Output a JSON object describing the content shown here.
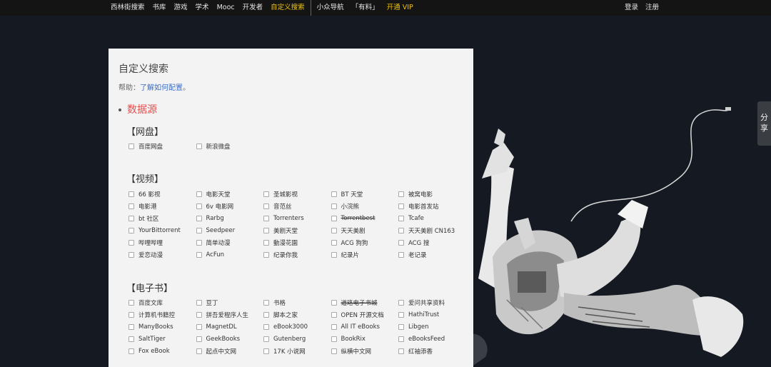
{
  "topnav": {
    "items": [
      "西林街搜索",
      "书库",
      "游戏",
      "学术",
      "Mooc",
      "开发者",
      "自定义搜索",
      "小众导航",
      "「有料」",
      "开通 VIP"
    ],
    "active": "自定义搜索",
    "login": "登录",
    "register": "注册"
  },
  "share": {
    "label": "分享"
  },
  "panel": {
    "title": "自定义搜索",
    "help_prefix": "帮助：",
    "help_link": "了解如何配置",
    "help_suffix": "。",
    "section_title": "数据源"
  },
  "groups": [
    {
      "title": "【网盘】",
      "items": [
        {
          "label": "百度网盘"
        },
        {
          "label": "新浪微盘"
        }
      ]
    },
    {
      "title": "【视频】",
      "items": [
        {
          "label": "66 影视"
        },
        {
          "label": "电影天堂"
        },
        {
          "label": "圣城影视"
        },
        {
          "label": "BT 天堂"
        },
        {
          "label": "被窝电影"
        },
        {
          "label": "电影港"
        },
        {
          "label": "6v 电影网"
        },
        {
          "label": "音范丝"
        },
        {
          "label": "小浣熊"
        },
        {
          "label": "电影首发站"
        },
        {
          "label": "bt 社区"
        },
        {
          "label": "Rarbg"
        },
        {
          "label": "Torrenters"
        },
        {
          "label": "Torrentbest",
          "strike": true
        },
        {
          "label": "Tcafe"
        },
        {
          "label": "YourBittorrent"
        },
        {
          "label": "Seedpeer"
        },
        {
          "label": "美剧天堂"
        },
        {
          "label": "天天美剧"
        },
        {
          "label": "天天美剧 CN163"
        },
        {
          "label": "哔哩哔哩"
        },
        {
          "label": "简单动漫"
        },
        {
          "label": "動漫花園"
        },
        {
          "label": "ACG 狗狗"
        },
        {
          "label": "ACG 搜"
        },
        {
          "label": "爱恋动漫"
        },
        {
          "label": "AcFun"
        },
        {
          "label": "纪录你我"
        },
        {
          "label": "纪录片"
        },
        {
          "label": "老记录"
        }
      ]
    },
    {
      "title": "【电子书】",
      "items": [
        {
          "label": "百度文库"
        },
        {
          "label": "豆丁"
        },
        {
          "label": "书格"
        },
        {
          "label": "道珞电子书城",
          "strike": true
        },
        {
          "label": "爱问共享资料"
        },
        {
          "label": "计算机书籍控"
        },
        {
          "label": "拼吾爱程序人生"
        },
        {
          "label": "脚本之家"
        },
        {
          "label": "OPEN 开源文档"
        },
        {
          "label": "HathiTrust"
        },
        {
          "label": "ManyBooks"
        },
        {
          "label": "MagnetDL"
        },
        {
          "label": "eBook3000"
        },
        {
          "label": "All IT eBooks"
        },
        {
          "label": "Libgen"
        },
        {
          "label": "SaltTiger"
        },
        {
          "label": "GeekBooks"
        },
        {
          "label": "Gutenberg"
        },
        {
          "label": "BookRix"
        },
        {
          "label": "eBooksFeed"
        },
        {
          "label": "Fox eBook"
        },
        {
          "label": "起点中文网"
        },
        {
          "label": "17K 小说网"
        },
        {
          "label": "纵横中文网"
        },
        {
          "label": "红袖添香"
        }
      ]
    }
  ]
}
